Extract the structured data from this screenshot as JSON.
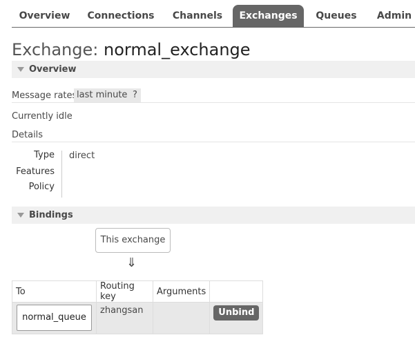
{
  "nav": {
    "tabs": [
      {
        "label": "Overview"
      },
      {
        "label": "Connections"
      },
      {
        "label": "Channels"
      },
      {
        "label": "Exchanges",
        "active": true
      },
      {
        "label": "Queues"
      },
      {
        "label": "Admin"
      }
    ]
  },
  "page": {
    "title_prefix": "Exchange:",
    "title_name": "normal_exchange"
  },
  "overview": {
    "heading": "Overview",
    "message_rates_label": "Message rates",
    "rates_period": "last minute",
    "help": "?",
    "status": "Currently idle",
    "details_label": "Details",
    "details": [
      {
        "label": "Type",
        "value": "direct"
      },
      {
        "label": "Features",
        "value": ""
      },
      {
        "label": "Policy",
        "value": ""
      }
    ]
  },
  "bindings": {
    "heading": "Bindings",
    "this_exchange": "This exchange",
    "arrow": "⇓",
    "columns": [
      "To",
      "Routing key",
      "Arguments",
      ""
    ],
    "rows": [
      {
        "to": "normal_queue",
        "routing_key": "zhangsan",
        "arguments": "",
        "action": "Unbind"
      }
    ]
  },
  "colors": {
    "tab_active_bg": "#666666",
    "section_bg": "#f0f0f0",
    "cell_bg": "#e8e8e8"
  }
}
